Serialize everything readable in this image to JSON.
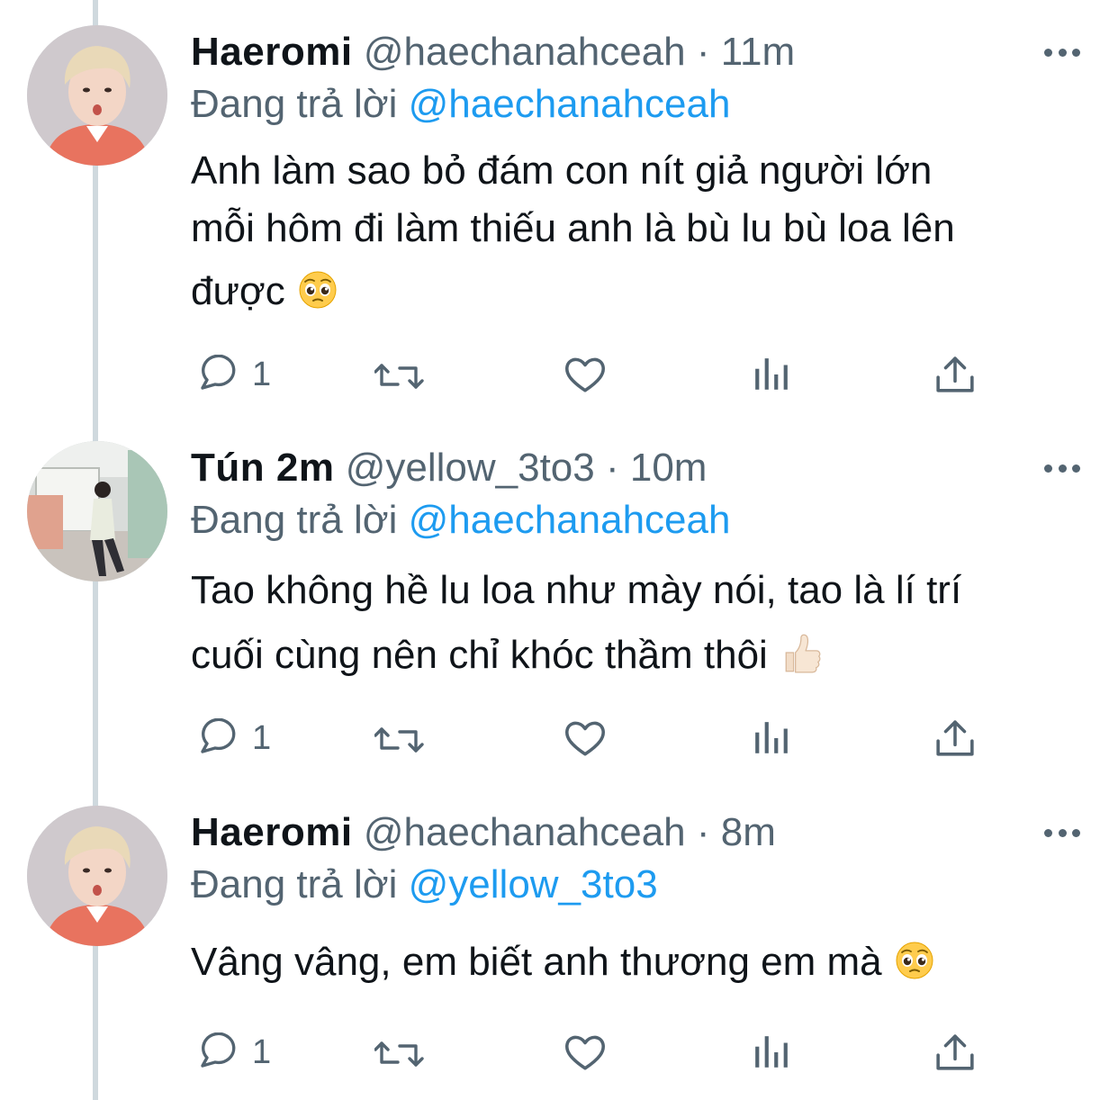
{
  "tweets": [
    {
      "name": "Haeromi",
      "handle": "@haechanahceah",
      "dot": "·",
      "time": "11m",
      "replying_prefix": "Đang trả lời",
      "replying_to": "@haechanahceah",
      "text_lines": [
        "Anh làm sao bỏ đám con nít giả người lớn",
        "mỗi hôm đi làm thiếu anh là bù lu bù loa lên",
        "được"
      ],
      "emoji": "pleading-face",
      "reply_count": "1",
      "avatar": "haeromi-avatar"
    },
    {
      "name": "Tún 2m",
      "handle": "@yellow_3to3",
      "dot": "·",
      "time": "10m",
      "replying_prefix": "Đang trả lời",
      "replying_to": "@haechanahceah",
      "text_lines": [
        "Tao không hề lu loa như mày nói, tao là lí trí",
        "cuối cùng nên chỉ khóc thầm thôi"
      ],
      "emoji": "thumbs-up",
      "reply_count": "1",
      "avatar": "tun-avatar"
    },
    {
      "name": "Haeromi",
      "handle": "@haechanahceah",
      "dot": "·",
      "time": "8m",
      "replying_prefix": "Đang trả lời",
      "replying_to": "@yellow_3to3",
      "text_lines": [
        "Vâng vâng, em biết anh thương em mà"
      ],
      "emoji": "pleading-face",
      "reply_count": "1",
      "avatar": "haeromi-avatar"
    }
  ],
  "icons": [
    "reply-icon",
    "retweet-icon",
    "like-icon",
    "analytics-icon",
    "share-icon",
    "more-icon"
  ],
  "colors": {
    "link": "#1d9bf0",
    "secondary": "#536471",
    "text": "#0f1419",
    "thread_line": "#cfd9de"
  }
}
